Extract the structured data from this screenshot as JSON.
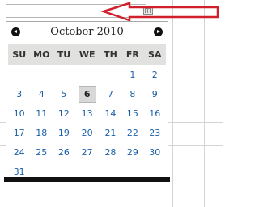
{
  "input": {
    "value": ""
  },
  "datepicker": {
    "title": "October 2010",
    "weekdays": [
      "SU",
      "MO",
      "TU",
      "WE",
      "TH",
      "FR",
      "SA"
    ],
    "weeks": [
      [
        "",
        "",
        "",
        "",
        "",
        "1",
        "2"
      ],
      [
        "3",
        "4",
        "5",
        "6",
        "7",
        "8",
        "9"
      ],
      [
        "10",
        "11",
        "12",
        "13",
        "14",
        "15",
        "16"
      ],
      [
        "17",
        "18",
        "19",
        "20",
        "21",
        "22",
        "23"
      ],
      [
        "24",
        "25",
        "26",
        "27",
        "28",
        "29",
        "30"
      ],
      [
        "31",
        "",
        "",
        "",
        "",
        "",
        ""
      ]
    ],
    "today": "6"
  },
  "icons": {
    "prev": "prev-month-icon",
    "next": "next-month-icon",
    "trigger": "calendar-icon"
  },
  "colors": {
    "day_text": "#1a5fa8",
    "header_bg": "#e1e1df",
    "arrow": "#d0202c"
  }
}
